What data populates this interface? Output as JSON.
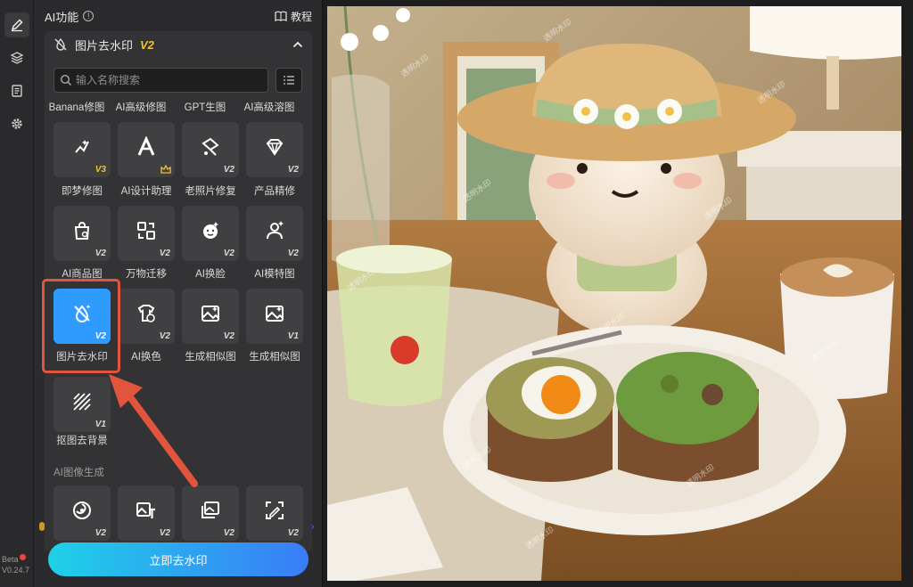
{
  "panel": {
    "title": "AI功能",
    "tutorial_label": "教程",
    "section_title": "图片去水印",
    "section_version": "V2",
    "search_placeholder": "输入名称搜索"
  },
  "top_labels": [
    "Banana修图",
    "AI高级修图",
    "GPT生图",
    "AI高级溶图"
  ],
  "tools": [
    {
      "label": "即梦修图",
      "version": "V3",
      "gold": true,
      "icon": "star-brush-icon"
    },
    {
      "label": "AI设计助理",
      "version": "",
      "crown": true,
      "icon": "ai-letter-icon"
    },
    {
      "label": "老照片修复",
      "version": "V2",
      "icon": "photo-repair-icon"
    },
    {
      "label": "产品精修",
      "version": "V2",
      "icon": "gem-icon"
    },
    {
      "label": "AI商品图",
      "version": "V2",
      "icon": "shopping-bag-icon"
    },
    {
      "label": "万物迁移",
      "version": "V2",
      "icon": "transfer-icon"
    },
    {
      "label": "AI换脸",
      "version": "V2",
      "icon": "face-swap-icon"
    },
    {
      "label": "AI模特图",
      "version": "V2",
      "icon": "model-icon"
    },
    {
      "label": "图片去水印",
      "version": "V2",
      "selected": true,
      "icon": "watermark-remove-icon"
    },
    {
      "label": "AI换色",
      "version": "V2",
      "icon": "color-change-icon"
    },
    {
      "label": "生成相似图",
      "version": "V2",
      "icon": "similar-image-icon"
    },
    {
      "label": "生成相似图",
      "version": "V1",
      "icon": "similar-image-v1-icon"
    },
    {
      "label": "抠图去背景",
      "version": "V1",
      "icon": "cutout-icon"
    }
  ],
  "image_gen": {
    "section_label": "AI图像生成",
    "tiles": [
      {
        "version": "V2",
        "icon": "swirl-icon"
      },
      {
        "version": "V2",
        "icon": "image-text-icon"
      },
      {
        "version": "V2",
        "icon": "images-icon"
      },
      {
        "version": "V2",
        "icon": "image-edit-icon"
      }
    ]
  },
  "cta_label": "立即去水印",
  "app_version": {
    "beta": "Beta",
    "version": "V0.24.7"
  },
  "watermark_text": "透明水印",
  "colors": {
    "accent": "#2f9bff",
    "highlight": "#e0553b",
    "version_gold": "#f1c232"
  }
}
